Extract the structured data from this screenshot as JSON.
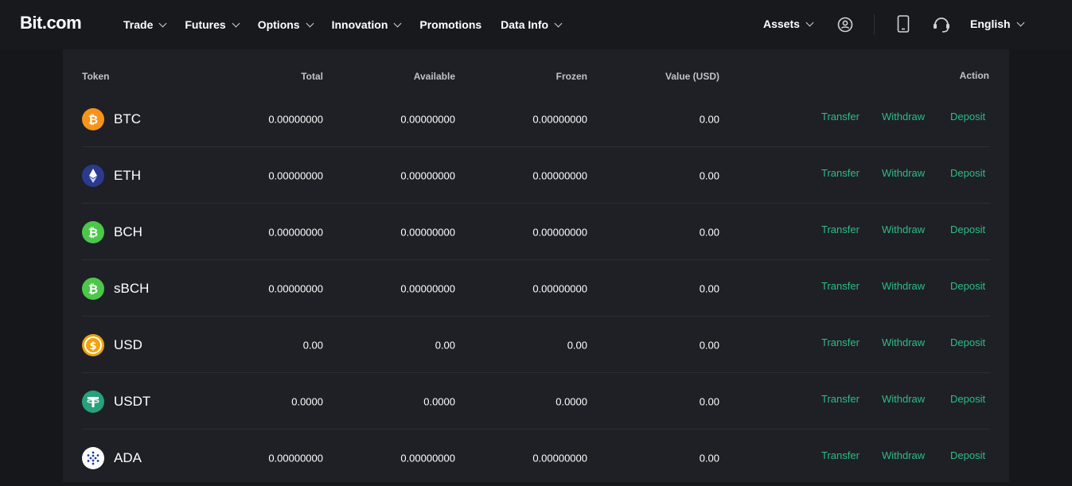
{
  "brand": {
    "logo": "Bit.com"
  },
  "nav": {
    "items": [
      {
        "label": "Trade",
        "dropdown": true
      },
      {
        "label": "Futures",
        "dropdown": true
      },
      {
        "label": "Options",
        "dropdown": true
      },
      {
        "label": "Innovation",
        "dropdown": true
      },
      {
        "label": "Promotions",
        "dropdown": false
      },
      {
        "label": "Data Info",
        "dropdown": true
      }
    ],
    "assets_label": "Assets",
    "language_label": "English"
  },
  "table": {
    "headers": {
      "token": "Token",
      "total": "Total",
      "available": "Available",
      "frozen": "Frozen",
      "value": "Value (USD)",
      "action": "Action"
    },
    "actions": {
      "transfer": "Transfer",
      "withdraw": "Withdraw",
      "deposit": "Deposit"
    },
    "rows": [
      {
        "symbol": "BTC",
        "icon": "btc-icon",
        "color": "#f7931a",
        "total": "0.00000000",
        "available": "0.00000000",
        "frozen": "0.00000000",
        "value": "0.00"
      },
      {
        "symbol": "ETH",
        "icon": "eth-icon",
        "color": "#2b3a8f",
        "total": "0.00000000",
        "available": "0.00000000",
        "frozen": "0.00000000",
        "value": "0.00"
      },
      {
        "symbol": "BCH",
        "icon": "bch-icon",
        "color": "#4cc74a",
        "total": "0.00000000",
        "available": "0.00000000",
        "frozen": "0.00000000",
        "value": "0.00"
      },
      {
        "symbol": "sBCH",
        "icon": "sbch-icon",
        "color": "#4cc74a",
        "total": "0.00000000",
        "available": "0.00000000",
        "frozen": "0.00000000",
        "value": "0.00"
      },
      {
        "symbol": "USD",
        "icon": "usd-icon",
        "color": "#f0a30a",
        "total": "0.00",
        "available": "0.00",
        "frozen": "0.00",
        "value": "0.00"
      },
      {
        "symbol": "USDT",
        "icon": "usdt-icon",
        "color": "#26a17b",
        "total": "0.0000",
        "available": "0.0000",
        "frozen": "0.0000",
        "value": "0.00"
      },
      {
        "symbol": "ADA",
        "icon": "ada-icon",
        "color": "#ffffff",
        "total": "0.00000000",
        "available": "0.00000000",
        "frozen": "0.00000000",
        "value": "0.00"
      }
    ]
  },
  "colors": {
    "accent": "#2ebd85",
    "panel": "#1e2026",
    "background": "#15171b"
  }
}
